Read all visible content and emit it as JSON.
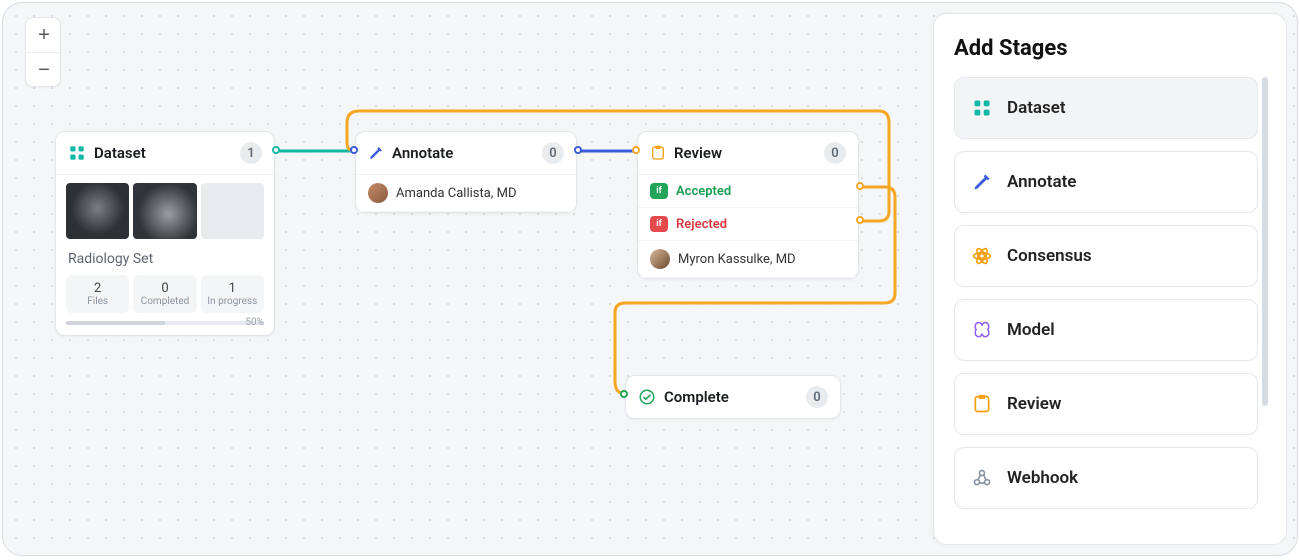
{
  "panel": {
    "title": "Add Stages",
    "items": [
      {
        "label": "Dataset",
        "icon": "dataset-icon",
        "color": "#14b8a6",
        "active": true
      },
      {
        "label": "Annotate",
        "icon": "annotate-icon",
        "color": "#3b5bdb",
        "active": false
      },
      {
        "label": "Consensus",
        "icon": "consensus-icon",
        "color": "#f59e0b",
        "active": false
      },
      {
        "label": "Model",
        "icon": "model-icon",
        "color": "#8b5cf6",
        "active": false
      },
      {
        "label": "Review",
        "icon": "review-icon",
        "color": "#f59e0b",
        "active": false
      },
      {
        "label": "Webhook",
        "icon": "webhook-icon",
        "color": "#8a95a1",
        "active": false
      }
    ]
  },
  "zoom": {
    "in_label": "+",
    "out_label": "−"
  },
  "nodes": {
    "dataset": {
      "title": "Dataset",
      "count": "1",
      "name": "Radiology Set",
      "stats": {
        "files": {
          "value": "2",
          "label": "Files"
        },
        "completed": {
          "value": "0",
          "label": "Completed"
        },
        "in_progress": {
          "value": "1",
          "label": "In progress"
        }
      },
      "progress_pct": "50%"
    },
    "annotate": {
      "title": "Annotate",
      "count": "0",
      "assignee": "Amanda Callista, MD"
    },
    "review": {
      "title": "Review",
      "count": "0",
      "if_label": "if",
      "accepted_label": "Accepted",
      "rejected_label": "Rejected",
      "assignee": "Myron Kassulke, MD"
    },
    "complete": {
      "title": "Complete",
      "count": "0"
    }
  },
  "colors": {
    "teal": "#14b8a6",
    "blue": "#3b5bdb",
    "orange": "#f5a623",
    "green": "#22a559",
    "purple": "#8b5cf6",
    "gray": "#8a95a1"
  }
}
